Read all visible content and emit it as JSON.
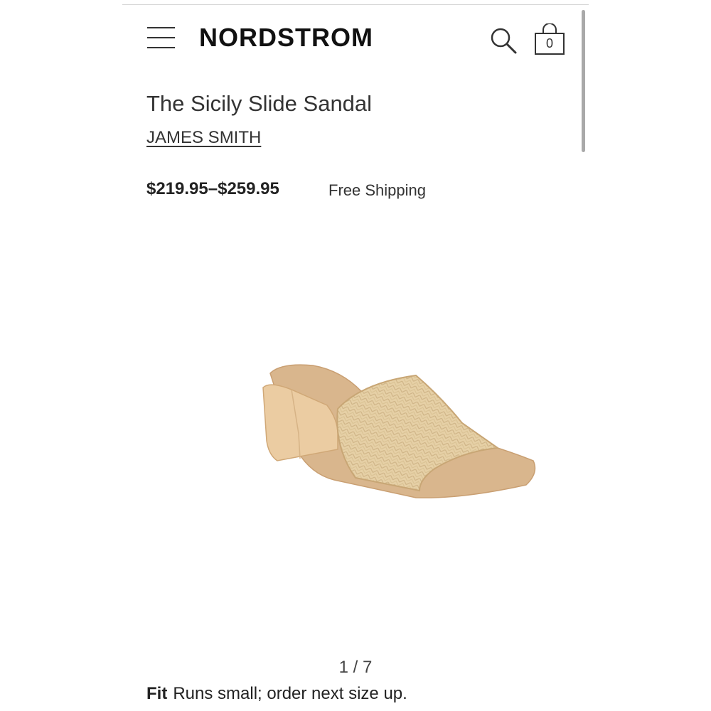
{
  "header": {
    "logo": "NORDSTROM",
    "bag_count": "0",
    "icons": [
      "menu-icon",
      "search-icon",
      "shopping-bag-icon"
    ]
  },
  "product": {
    "title": "The Sicily Slide Sandal",
    "brand": "JAMES SMITH",
    "price": "$219.95–$259.95",
    "shipping": "Free Shipping",
    "image_counter": "1 / 7",
    "image_index": 1,
    "image_total": 7,
    "fit_label": "Fit",
    "fit_text": "Runs small; order next size up."
  },
  "colors": {
    "raffia": "#e6cfa4",
    "heel": "#e8c79d",
    "suede": "#d8b58c",
    "text": "#222222"
  }
}
